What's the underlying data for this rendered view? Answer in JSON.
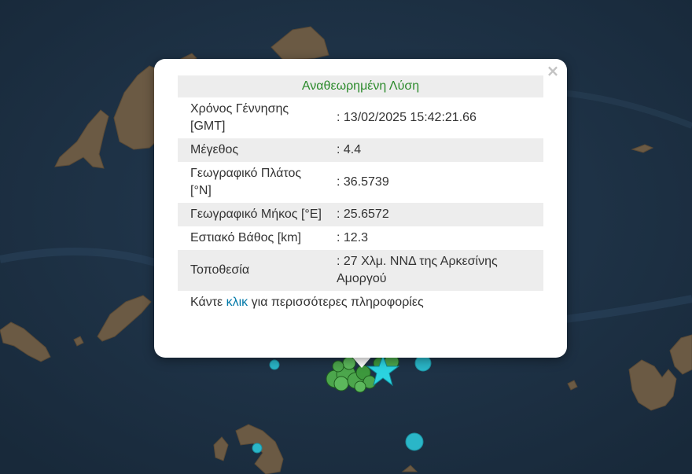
{
  "popup": {
    "close_glyph": "×",
    "header": "Αναθεωρημένη Λύση",
    "rows": [
      {
        "label": "Χρόνος Γέννησης [GMT]",
        "value": ": 13/02/2025 15:42:21.66"
      },
      {
        "label": "Μέγεθος",
        "value": ": 4.4"
      },
      {
        "label": "Γεωγραφικό Πλάτος [°N]",
        "value": ": 36.5739"
      },
      {
        "label": "Γεωγραφικό Μήκος [°E]",
        "value": ": 25.6572"
      },
      {
        "label": "Εστιακό Βάθος [km]",
        "value": ": 12.3"
      },
      {
        "label": "Τοποθεσία",
        "value": ": 27 Χλμ. ΝΝΔ της Αρκεσίνης Αμοργού"
      }
    ],
    "more": {
      "prefix": "Κάντε ",
      "link": "κλικ",
      "suffix": " για περισσότερες πληροφορίες"
    }
  },
  "map": {
    "sea_color": "#1f3448",
    "land_color": "#6b5a44",
    "quake_colors": {
      "recent": "#4ca64c",
      "older": "#2ab6c8",
      "latest_star": "#2bd3e0"
    }
  }
}
